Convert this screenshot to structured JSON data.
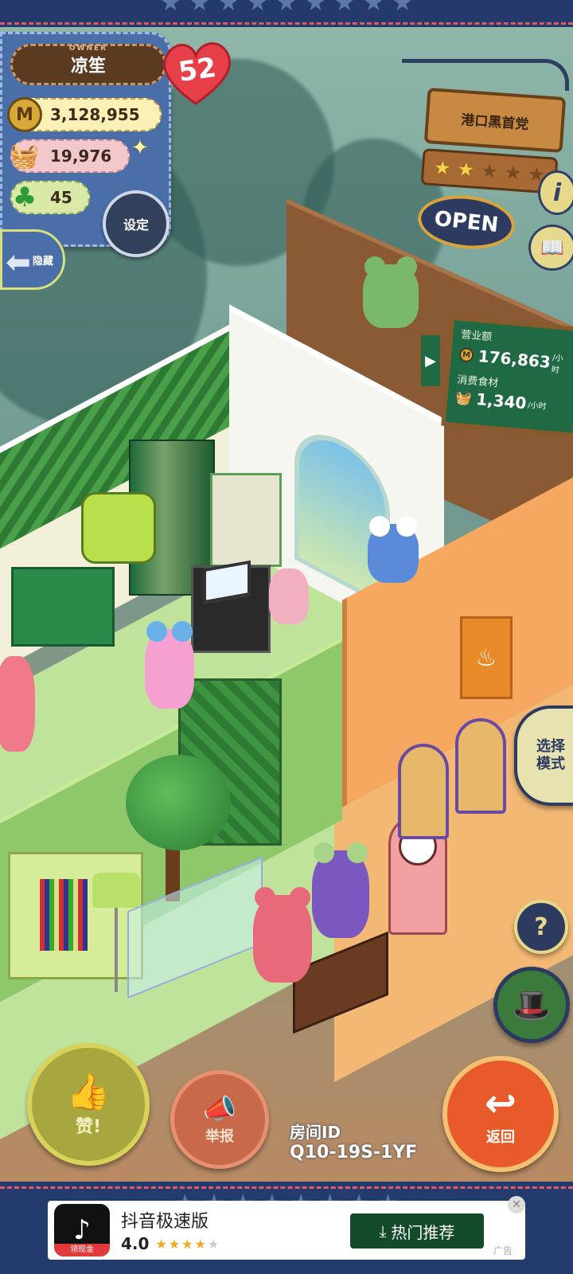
{
  "owner": {
    "label": "OWNER",
    "name": "凉笙",
    "coins": "3,128,955",
    "food": "19,976",
    "clovers": "45",
    "likes": "52",
    "settings_label": "设定",
    "hide_label": "隐藏"
  },
  "shop": {
    "name": "港口黑首党",
    "stars_filled": 2,
    "stars_total": 5,
    "open_label": "OPEN"
  },
  "sales_board": {
    "revenue_label": "营业额",
    "revenue_value": "176,863",
    "revenue_unit": "/小时",
    "food_label": "消费食材",
    "food_value": "1,340",
    "food_unit": "/小时"
  },
  "controls": {
    "mode_label": "选择 模式",
    "like_label": "赞!",
    "report_label": "举报",
    "return_label": "返回",
    "help_label": "?",
    "room_id_label": "房间ID",
    "room_id_value": "Q10-19S-1YF"
  },
  "ad": {
    "app_name": "抖音极速版",
    "rating": "4.0",
    "rating_value": 4,
    "cta_label": "热门推荐",
    "icon_tag": "领现金",
    "ad_label": "广告"
  },
  "colors": {
    "panel_blue": "#4a6fa8",
    "border_navy": "#233a6b",
    "return_orange": "#e85a2a",
    "board_green": "#1f6a44"
  }
}
